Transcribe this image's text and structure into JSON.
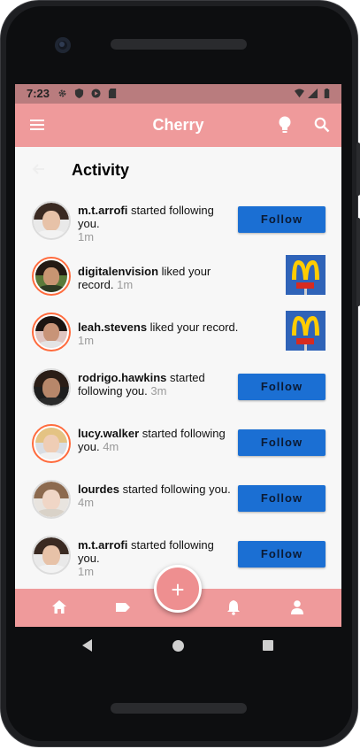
{
  "status_bar": {
    "time": "7:23"
  },
  "app_bar": {
    "title": "Cherry",
    "menu_icon": "menu-icon",
    "theme_icon": "lightbulb-icon",
    "search_icon": "search-icon"
  },
  "page": {
    "title": "Activity",
    "back_icon": "arrow-back-icon"
  },
  "follow_label": "Follow",
  "items": [
    {
      "user": "m.t.arrofi",
      "text": " started following you.",
      "time": "1m",
      "action": "follow"
    },
    {
      "user": "digitalenvision",
      "text": " liked your record.",
      "time": "1m",
      "action": "thumbnail"
    },
    {
      "user": "leah.stevens",
      "text": " liked your record.",
      "time": "1m",
      "action": "thumbnail"
    },
    {
      "user": "rodrigo.hawkins",
      "text": " started following you.",
      "time": "3m",
      "action": "follow"
    },
    {
      "user": "lucy.walker",
      "text": " started following you.",
      "time": "4m",
      "action": "follow"
    },
    {
      "user": "lourdes",
      "text": " started following you.",
      "time": "4m",
      "action": "follow"
    },
    {
      "user": "m.t.arrofi",
      "text": " started following you.",
      "time": "1m",
      "action": "follow"
    }
  ],
  "bottom_nav": {
    "items": [
      "home-icon",
      "tag-icon",
      "bell-icon",
      "person-icon"
    ],
    "fab": "+"
  },
  "colors": {
    "primary": "#ef9a9b",
    "follow_button": "#1b6fd3"
  }
}
